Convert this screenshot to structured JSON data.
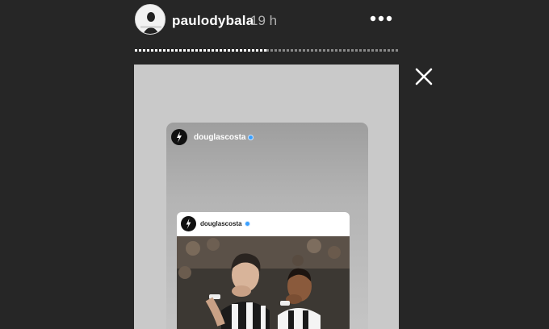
{
  "story_header": {
    "username": "paulodybala",
    "timestamp": "19 h",
    "more_icon": "more-horizontal-icon",
    "close_icon": "close-icon"
  },
  "progress": {
    "segments": 2,
    "current_segment_fill": 1.0
  },
  "shared_post": {
    "username": "douglascosta",
    "verified": true
  },
  "inner_post": {
    "username": "douglascosta",
    "verified": true,
    "image": "football-celebration-photo"
  },
  "colors": {
    "background": "#262626",
    "story_canvas": "#c9c9c9",
    "verified_badge": "#3aa0ff",
    "kit_black": "#1a1a1a",
    "kit_white": "#f4f4f4"
  }
}
